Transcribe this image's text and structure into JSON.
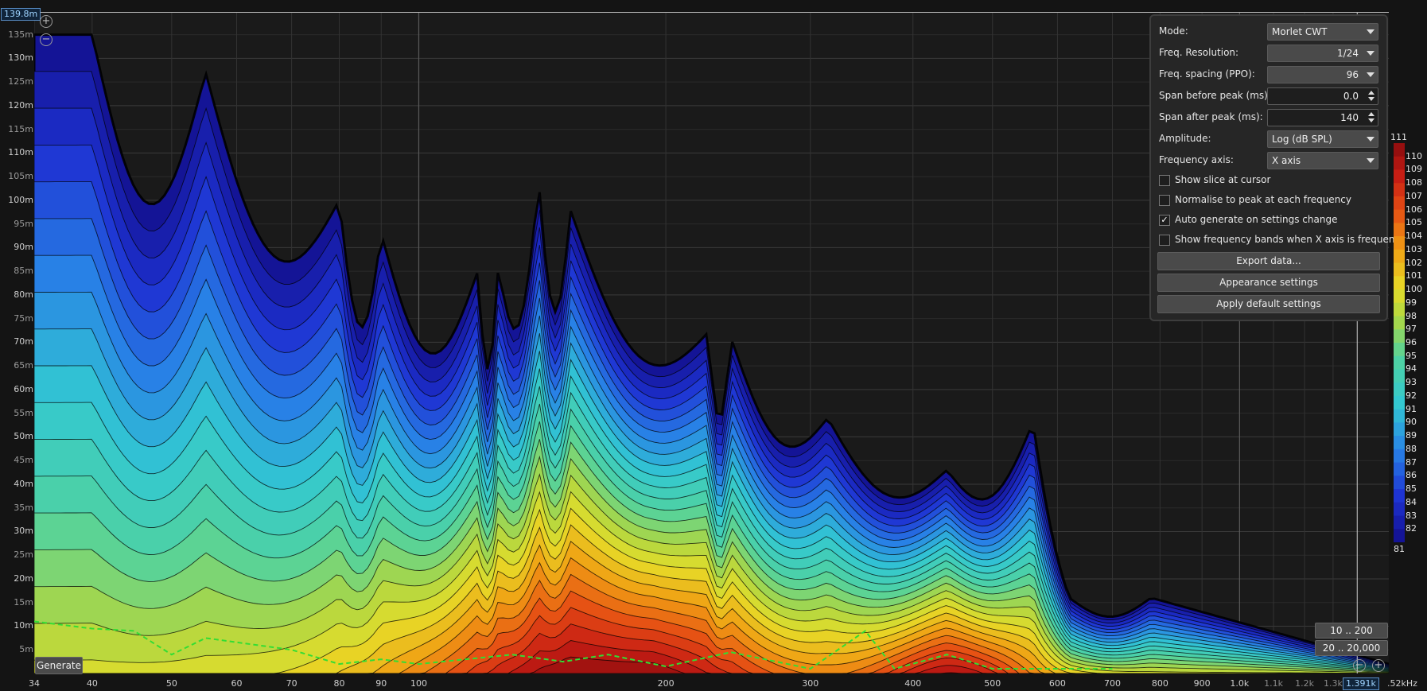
{
  "chart_data": {
    "type": "heatmap",
    "title": "",
    "xlabel": "",
    "ylabel": "",
    "x_scale": "log",
    "x_unit_label": "kHz",
    "xlim": [
      34,
      1520
    ],
    "ylim": [
      0,
      139.8
    ],
    "x_ticks": [
      "34",
      "40",
      "50",
      "60",
      "70",
      "80",
      "90",
      "100",
      "200",
      "300",
      "400",
      "500",
      "600",
      "700",
      "800",
      "900",
      "1.0k",
      "1.1k",
      "1.2k",
      "1.3k"
    ],
    "x_tick_values": [
      34,
      40,
      50,
      60,
      70,
      80,
      90,
      100,
      200,
      300,
      400,
      500,
      600,
      700,
      800,
      900,
      1000,
      1100,
      1200,
      1300
    ],
    "x_minor_ticks": [
      "1.1k",
      "1.2k",
      "1.3k"
    ],
    "y_ticks": [
      "5m",
      "10m",
      "15m",
      "20m",
      "25m",
      "30m",
      "35m",
      "40m",
      "45m",
      "50m",
      "55m",
      "60m",
      "65m",
      "70m",
      "75m",
      "80m",
      "85m",
      "90m",
      "95m",
      "100m",
      "105m",
      "110m",
      "115m",
      "120m",
      "125m",
      "130m",
      "135m"
    ],
    "y_tick_values": [
      5,
      10,
      15,
      20,
      25,
      30,
      35,
      40,
      45,
      50,
      55,
      60,
      65,
      70,
      75,
      80,
      85,
      90,
      95,
      100,
      105,
      110,
      115,
      120,
      125,
      130,
      135
    ],
    "y_top_value": "139.8m",
    "x_cursor_value": "1.391k",
    "x_end_label": ".52kHz",
    "colorbar": {
      "min_label": "81",
      "max_label": "111",
      "ticks": [
        "82",
        "83",
        "84",
        "85",
        "86",
        "87",
        "88",
        "89",
        "90",
        "91",
        "92",
        "93",
        "94",
        "95",
        "96",
        "97",
        "98",
        "99",
        "100",
        "101",
        "102",
        "103",
        "104",
        "105",
        "106",
        "107",
        "108",
        "109",
        "110"
      ]
    },
    "peak_ridges": [
      {
        "f": 40,
        "t": 135
      },
      {
        "f": 55,
        "t": 127
      },
      {
        "f": 80,
        "t": 100
      },
      {
        "f": 90,
        "t": 93
      },
      {
        "f": 118,
        "t": 85
      },
      {
        "f": 125,
        "t": 86
      },
      {
        "f": 140,
        "t": 104
      },
      {
        "f": 153,
        "t": 98
      },
      {
        "f": 225,
        "t": 72
      },
      {
        "f": 240,
        "t": 71
      },
      {
        "f": 315,
        "t": 54
      },
      {
        "f": 440,
        "t": 43
      },
      {
        "f": 560,
        "t": 53
      },
      {
        "f": 620,
        "t": 16
      },
      {
        "f": 780,
        "t": 16
      }
    ],
    "green_trace": [
      [
        34,
        11
      ],
      [
        40,
        9.5
      ],
      [
        45,
        9
      ],
      [
        50,
        4
      ],
      [
        55,
        7.5
      ],
      [
        70,
        5
      ],
      [
        80,
        2
      ],
      [
        90,
        3
      ],
      [
        100,
        2
      ],
      [
        130,
        4
      ],
      [
        150,
        2.5
      ],
      [
        170,
        4
      ],
      [
        200,
        1.5
      ],
      [
        240,
        4.5
      ],
      [
        300,
        1
      ],
      [
        350,
        9
      ],
      [
        380,
        1
      ],
      [
        440,
        4
      ],
      [
        500,
        1
      ],
      [
        700,
        1
      ]
    ]
  },
  "settings": {
    "mode": {
      "label": "Mode:",
      "value": "Morlet CWT"
    },
    "freq_resolution": {
      "label": "Freq. Resolution:",
      "value": "1/24"
    },
    "freq_spacing": {
      "label": "Freq. spacing (PPO):",
      "value": "96"
    },
    "span_before": {
      "label": "Span before peak (ms):",
      "value": "0.0"
    },
    "span_after": {
      "label": "Span after peak (ms):",
      "value": "140"
    },
    "amplitude": {
      "label": "Amplitude:",
      "value": "Log (dB SPL)"
    },
    "frequency_axis": {
      "label": "Frequency axis:",
      "value": "X axis"
    },
    "show_slice": {
      "label": "Show slice at cursor",
      "checked": false
    },
    "normalise": {
      "label": "Normalise to peak at each frequency",
      "checked": false
    },
    "auto_generate": {
      "label": "Auto generate on settings change",
      "checked": true
    },
    "show_bands": {
      "label": "Show frequency bands when X axis is frequency",
      "checked": false
    },
    "export_label": "Export data...",
    "appearance_label": "Appearance settings",
    "defaults_label": "Apply default settings"
  },
  "controls": {
    "generate_label": "Generate",
    "range_low": "10 .. 200",
    "range_high": "20 .. 20,000"
  }
}
